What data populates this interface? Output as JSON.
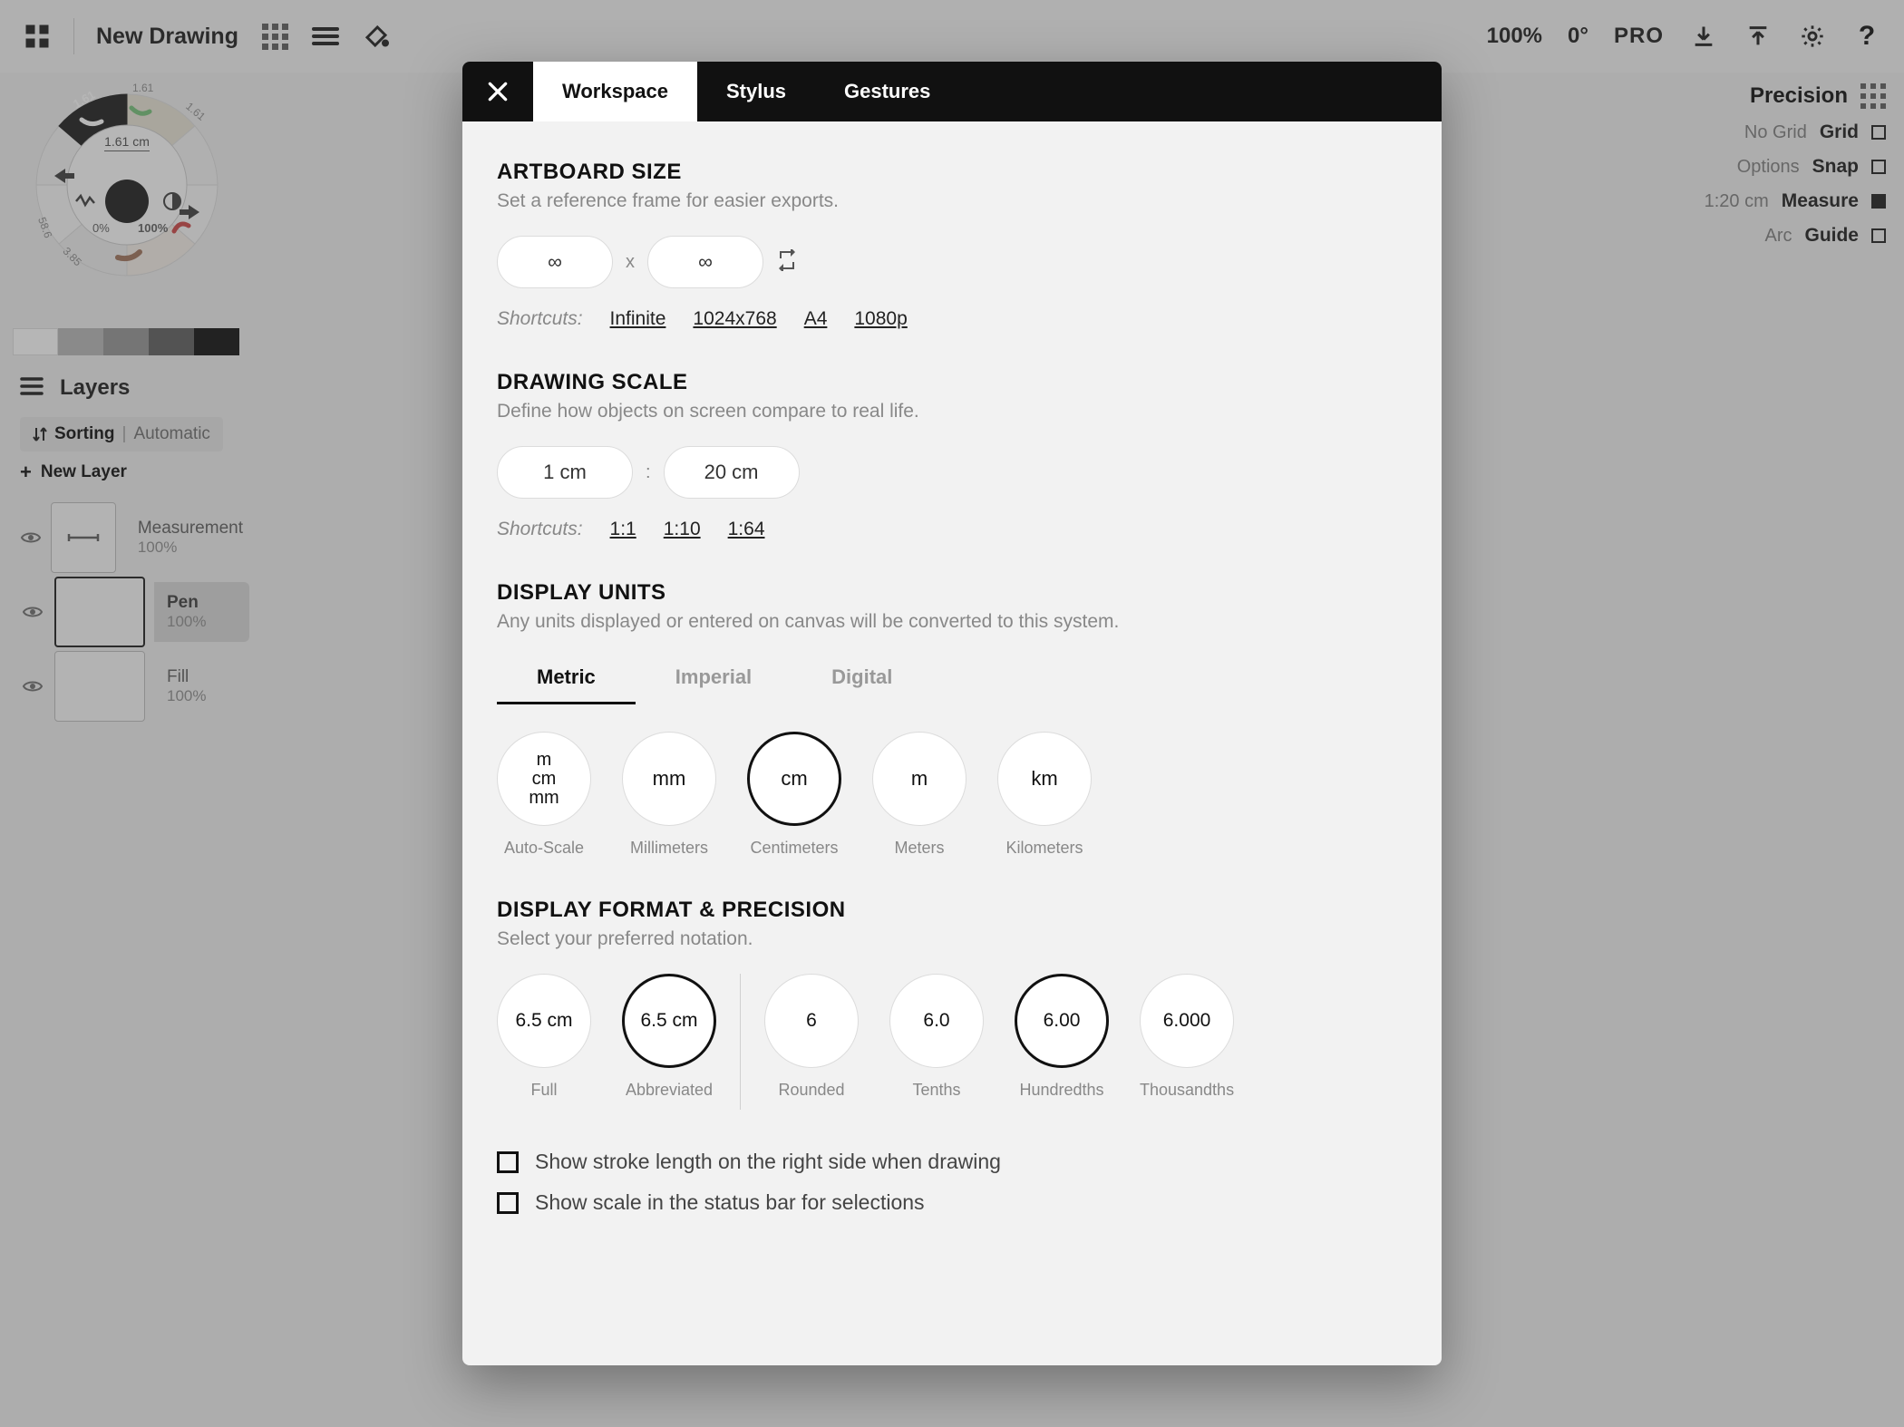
{
  "topbar": {
    "doc_title": "New Drawing",
    "zoom": "100%",
    "rotation": "0°",
    "pro": "PRO"
  },
  "right_panel": {
    "title": "Precision",
    "rows": [
      {
        "label": "No Grid",
        "value": "Grid",
        "filled": false
      },
      {
        "label": "Options",
        "value": "Snap",
        "filled": false
      },
      {
        "label": "1:20 cm",
        "value": "Measure",
        "filled": true
      },
      {
        "label": "Arc",
        "value": "Guide",
        "filled": false
      }
    ]
  },
  "radial": {
    "center_label": "1.61 cm",
    "percent_left": "0%",
    "percent_right": "100%",
    "small_labels": [
      "1.61",
      "1.61",
      "1.61",
      "3.85",
      "58.6"
    ]
  },
  "swatches": [
    "#ffffff",
    "#b3b3b3",
    "#8f8f8f",
    "#555555",
    "#000000"
  ],
  "layers": {
    "title": "Layers",
    "sorting": {
      "bold": "Sorting",
      "sep": "|",
      "auto": "Automatic"
    },
    "new_layer": "New Layer",
    "items": [
      {
        "name": "Measurement",
        "pct": "100%",
        "icon": "measure",
        "selected": false
      },
      {
        "name": "Pen",
        "pct": "100%",
        "icon": "blank",
        "selected": true
      },
      {
        "name": "Fill",
        "pct": "100%",
        "icon": "blank",
        "selected": false
      }
    ]
  },
  "modal": {
    "tabs": [
      "Workspace",
      "Stylus",
      "Gestures"
    ],
    "active_tab": "Workspace",
    "artboard": {
      "title": "ARTBOARD SIZE",
      "desc": "Set a reference frame for easier exports.",
      "width": "∞",
      "height": "∞",
      "sep": "x",
      "shortcuts_label": "Shortcuts:",
      "shortcuts": [
        "Infinite",
        "1024x768",
        "A4",
        "1080p"
      ]
    },
    "scale": {
      "title": "DRAWING SCALE",
      "desc": "Define how objects on screen compare to real life.",
      "left": "1 cm",
      "colon": ":",
      "right": "20 cm",
      "shortcuts_label": "Shortcuts:",
      "shortcuts": [
        "1:1",
        "1:10",
        "1:64"
      ]
    },
    "units": {
      "title": "DISPLAY UNITS",
      "desc": "Any units displayed or entered on canvas will be converted to this system.",
      "tabs": [
        "Metric",
        "Imperial",
        "Digital"
      ],
      "active": "Metric",
      "options": [
        {
          "stack": [
            "m",
            "cm",
            "mm"
          ],
          "label": "Auto-Scale",
          "selected": false
        },
        {
          "value": "mm",
          "label": "Millimeters",
          "selected": false
        },
        {
          "value": "cm",
          "label": "Centimeters",
          "selected": true
        },
        {
          "value": "m",
          "label": "Meters",
          "selected": false
        },
        {
          "value": "km",
          "label": "Kilometers",
          "selected": false
        }
      ]
    },
    "format": {
      "title": "DISPLAY FORMAT & PRECISION",
      "desc": "Select your preferred notation.",
      "left_group": [
        {
          "value": "6.5 cm",
          "label": "Full",
          "selected": false
        },
        {
          "value": "6.5 cm",
          "label": "Abbreviated",
          "selected": true
        }
      ],
      "right_group": [
        {
          "value": "6",
          "label": "Rounded",
          "selected": false
        },
        {
          "value": "6.0",
          "label": "Tenths",
          "selected": false
        },
        {
          "value": "6.00",
          "label": "Hundredths",
          "selected": true
        },
        {
          "value": "6.000",
          "label": "Thousandths",
          "selected": false
        }
      ]
    },
    "checks": [
      "Show stroke length on the right side when drawing",
      "Show scale in the status bar for selections"
    ]
  }
}
